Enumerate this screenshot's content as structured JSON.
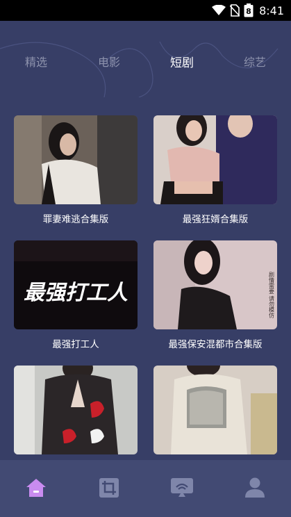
{
  "status_bar": {
    "time": "8:41",
    "battery_level": "8"
  },
  "tabs": [
    {
      "label": "精选",
      "active": false
    },
    {
      "label": "电影",
      "active": false
    },
    {
      "label": "短剧",
      "active": true
    },
    {
      "label": "综艺",
      "active": false
    }
  ],
  "cards": [
    {
      "title": "罪妻难逃合集版",
      "thumb_text": ""
    },
    {
      "title": "最强狂婿合集版",
      "thumb_text": ""
    },
    {
      "title": "最强打工人",
      "thumb_text": "最强打工人"
    },
    {
      "title": "最强保安混都市合集版",
      "thumb_text": "剧情需要 请勿模仿"
    },
    {
      "title": "",
      "thumb_text": ""
    },
    {
      "title": "",
      "thumb_text": ""
    }
  ],
  "bottom_nav": [
    {
      "icon": "home-icon",
      "active": true
    },
    {
      "icon": "crop-icon",
      "active": false
    },
    {
      "icon": "cast-icon",
      "active": false
    },
    {
      "icon": "user-icon",
      "active": false
    }
  ],
  "colors": {
    "background": "#373e66",
    "navbar": "#424a73",
    "active_icon": "#c98cf0",
    "inactive_icon": "#7f86aa",
    "inactive_tab": "#8e93ad"
  }
}
